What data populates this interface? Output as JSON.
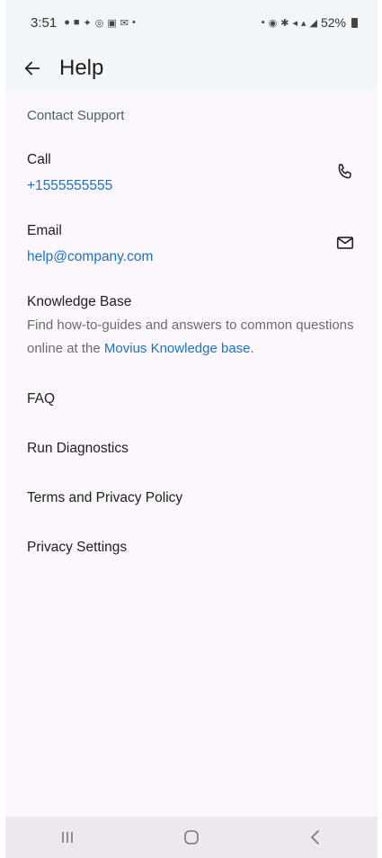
{
  "status_bar": {
    "time": "3:51",
    "battery": "52%"
  },
  "app_bar": {
    "title": "Help"
  },
  "contact_support": {
    "header": "Contact Support",
    "call": {
      "label": "Call",
      "value": "+1555555555",
      "icon": "phone-icon"
    },
    "email": {
      "label": "Email",
      "value": "help@company.com",
      "icon": "mail-icon"
    }
  },
  "knowledge_base": {
    "title": "Knowledge Base",
    "description_prefix": "Find how-to-guides and answers to common questions online at the ",
    "link_text": "Movius Knowledge base",
    "description_suffix": "."
  },
  "menu": {
    "faq": "FAQ",
    "run_diagnostics": "Run Diagnostics",
    "terms": "Terms and Privacy Policy",
    "privacy_settings": "Privacy Settings"
  },
  "colors": {
    "accent": "#1a73c8",
    "header_bg": "#f2f6f8",
    "page_bg": "#fbf7fc"
  }
}
